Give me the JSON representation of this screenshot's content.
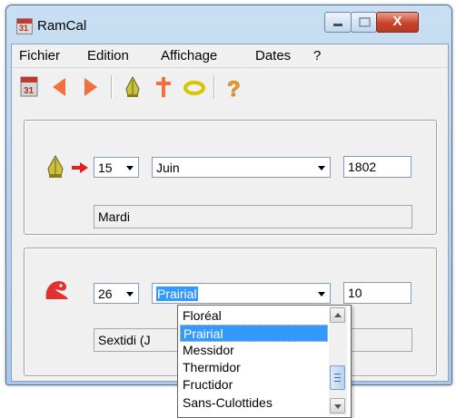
{
  "window": {
    "title": "RamCal",
    "close_glyph": "X"
  },
  "menu": [
    "Fichier",
    "Edition",
    "Affichage",
    "Dates",
    "?"
  ],
  "toolbar": {
    "icons": [
      "calendar-icon",
      "previous-arrow-icon",
      "next-arrow-icon",
      "mitre-icon",
      "cross-icon",
      "ring-icon",
      "help-icon"
    ]
  },
  "gregorian": {
    "day": "15",
    "month": "Juin",
    "year": "1802",
    "weekday": "Mardi"
  },
  "republican": {
    "day": "26",
    "month": "Prairial",
    "year": "10",
    "weekday": "Sextidi (J"
  },
  "dropdown": {
    "items": [
      "Floréal",
      "Prairial",
      "Messidor",
      "Thermidor",
      "Fructidor",
      "Sans-Culottides"
    ],
    "selected_index": 1
  },
  "colors": {
    "selection": "#3399ff",
    "arrow": "#e8602c"
  }
}
